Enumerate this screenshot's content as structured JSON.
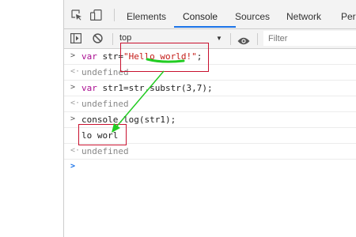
{
  "devtools": {
    "tabs": [
      {
        "label": "Elements"
      },
      {
        "label": "Console"
      },
      {
        "label": "Sources"
      },
      {
        "label": "Network"
      },
      {
        "label": "Per"
      }
    ],
    "active_tab": "Console",
    "icons": {
      "inspect": "inspect-element-icon",
      "device": "device-toolbar-icon",
      "sidebar": "console-sidebar-icon",
      "clear": "clear-console-icon",
      "eye": "live-expression-icon",
      "dropdown": "chevron-down-icon"
    },
    "toolbar": {
      "context": "top",
      "filter_placeholder": "Filter"
    }
  },
  "console": {
    "lines": [
      {
        "kind": "input",
        "prefix": ">",
        "keyword": "var",
        "code": " str=",
        "string": "\"Hello world!\"",
        "tail": ";"
      },
      {
        "kind": "output",
        "prefix": "<·",
        "text": "undefined"
      },
      {
        "kind": "input",
        "prefix": ">",
        "keyword": "var",
        "code": " str1=str.substr(3,7);"
      },
      {
        "kind": "output",
        "prefix": "<·",
        "text": "undefined"
      },
      {
        "kind": "input",
        "prefix": ">",
        "code": "console.log(str1);"
      },
      {
        "kind": "log",
        "text": "lo worl"
      },
      {
        "kind": "output",
        "prefix": "<·",
        "text": "undefined"
      },
      {
        "kind": "prompt",
        "prefix": ">"
      }
    ]
  },
  "annotation": {
    "color": "#c8102e",
    "arrow_color": "#22cc22"
  }
}
